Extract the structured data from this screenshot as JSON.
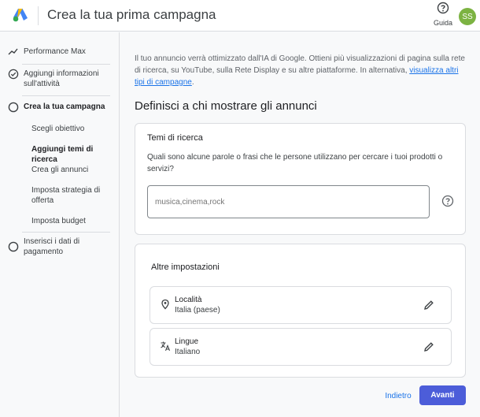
{
  "header": {
    "title": "Crea la tua prima campagna",
    "help_label": "Guida",
    "avatar_initials": "SS",
    "avatar_color": "#7cb342"
  },
  "sidebar": {
    "top_item": "Performance Max",
    "steps": [
      {
        "label": "Aggiungi informazioni sull'attività",
        "status": "completed"
      },
      {
        "label": "Crea la tua campagna",
        "status": "current"
      },
      {
        "label": "Inserisci i dati di pagamento",
        "status": "pending"
      }
    ],
    "substeps": [
      {
        "label": "Scegli obiettivo"
      },
      {
        "label": "Aggiungi temi di ricerca",
        "active": true
      },
      {
        "label": "Crea gli annunci"
      },
      {
        "label": "Imposta strategia di offerta"
      },
      {
        "label": "Imposta budget"
      }
    ]
  },
  "main": {
    "intro_text": "Il tuo annuncio verrà ottimizzato dall'IA di Google. Ottieni più visualizzazioni di pagina sulla rete di ricerca, su YouTube, sulla Rete Display e su altre piattaforme. In alternativa, ",
    "intro_link": "visualizza altri tipi di campagne",
    "intro_end": ".",
    "section_title": "Definisci a chi mostrare gli annunci",
    "search_themes": {
      "title": "Temi di ricerca",
      "question": "Quali sono alcune parole o frasi che le persone utilizzano per cercare i tuoi prodotti o servizi?",
      "placeholder": "musica,cinema,rock"
    },
    "other_settings": {
      "title": "Altre impostazioni",
      "rows": [
        {
          "title": "Località",
          "value": "Italia (paese)",
          "icon": "location-pin-icon"
        },
        {
          "title": "Lingue",
          "value": "Italiano",
          "icon": "translate-icon"
        }
      ]
    }
  },
  "footer": {
    "back_label": "Indietro",
    "next_label": "Avanti",
    "accent_color": "#4c5dd9",
    "link_color": "#1a73e8"
  }
}
